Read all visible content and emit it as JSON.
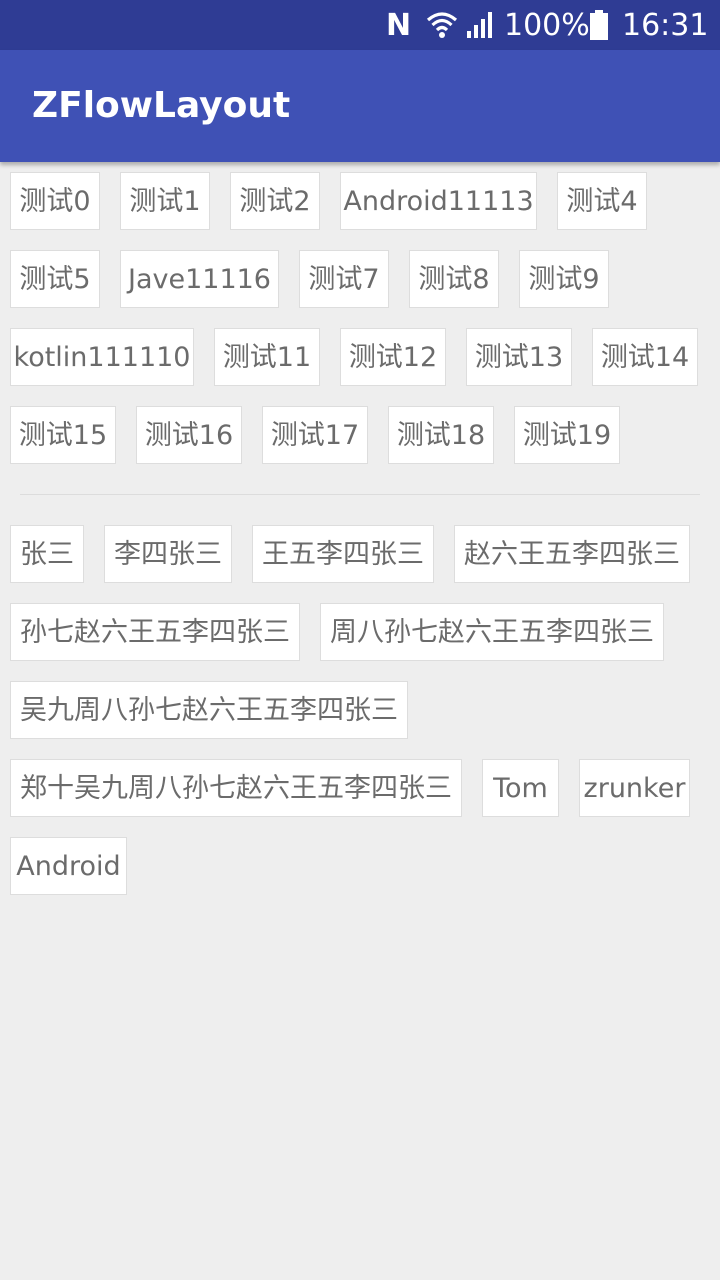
{
  "status_bar": {
    "nfc_label": "N",
    "battery_percent": "100%",
    "time": "16:31",
    "icons": [
      "nfc-icon",
      "wifi-icon",
      "signal-icon",
      "battery-icon"
    ]
  },
  "app_bar": {
    "title": "ZFlowLayout",
    "color": "#3f51b5"
  },
  "flow_top": [
    "测试0",
    "测试1",
    "测试2",
    "Android11113",
    "测试4",
    "测试5",
    "Jave11116",
    "测试7",
    "测试8",
    "测试9",
    "kotlin111110",
    "测试11",
    "测试12",
    "测试13",
    "测试14",
    "测试15",
    "测试16",
    "测试17",
    "测试18",
    "测试19"
  ],
  "flow_bottom": [
    "张三",
    "李四张三",
    "王五李四张三",
    "赵六王五李四张三",
    "孙七赵六王五李四张三",
    "周八孙七赵六王五李四张三",
    "吴九周八孙七赵六王五李四张三",
    "郑十吴九周八孙七赵六王五李四张三",
    "Tom",
    "zrunker",
    "Android"
  ]
}
